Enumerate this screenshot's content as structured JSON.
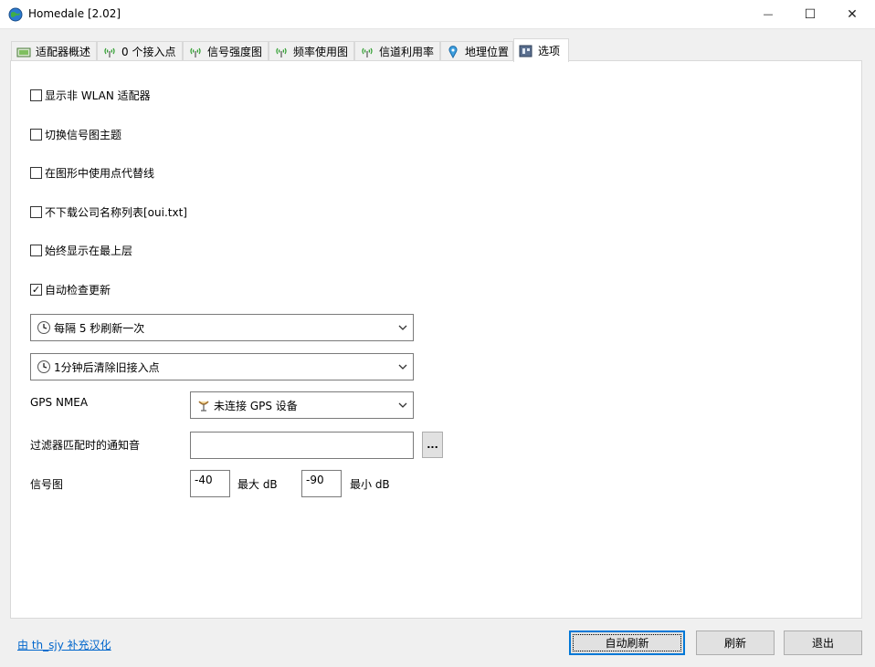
{
  "window": {
    "title": "Homedale [2.02]",
    "minimize_glyph": "—",
    "maximize_glyph": "☐",
    "close_glyph": "✕"
  },
  "tabs": [
    {
      "label": "适配器概述",
      "icon": "adapter-icon"
    },
    {
      "label": "0 个接入点",
      "icon": "antenna-icon"
    },
    {
      "label": "信号强度图",
      "icon": "antenna-icon"
    },
    {
      "label": "频率使用图",
      "icon": "antenna-icon"
    },
    {
      "label": "信道利用率",
      "icon": "antenna-icon"
    },
    {
      "label": "地理位置",
      "icon": "map-pin-icon"
    },
    {
      "label": "选项",
      "icon": "options-icon",
      "active": true
    }
  ],
  "options": {
    "checkboxes": [
      {
        "label": "显示非 WLAN 适配器",
        "checked": false
      },
      {
        "label": "切换信号图主题",
        "checked": false
      },
      {
        "label": "在图形中使用点代替线",
        "checked": false
      },
      {
        "label": "不下载公司名称列表[oui.txt]",
        "checked": false
      },
      {
        "label": "始终显示在最上层",
        "checked": false
      },
      {
        "label": "自动检查更新",
        "checked": true
      }
    ],
    "check_glyph": "✓",
    "refresh_interval": "每隔 5 秒刷新一次",
    "clear_old": "1分钟后清除旧接入点",
    "gps_label": "GPS NMEA",
    "gps_value": "未连接 GPS 设备",
    "sound_label": "过滤器匹配时的通知音",
    "sound_value": "",
    "browse_label": "...",
    "signal_label": "信号图",
    "max_db_value": "-40",
    "max_db_label": "最大 dB",
    "min_db_value": "-90",
    "min_db_label": "最小 dB"
  },
  "footer": {
    "credit_link": "由 th_sjy 补充汉化",
    "auto_refresh": "自动刷新",
    "refresh": "刷新",
    "exit": "退出"
  },
  "colors": {
    "accent": "#0078d7",
    "link": "#0066cc",
    "antenna_green": "#2e9e2e"
  }
}
